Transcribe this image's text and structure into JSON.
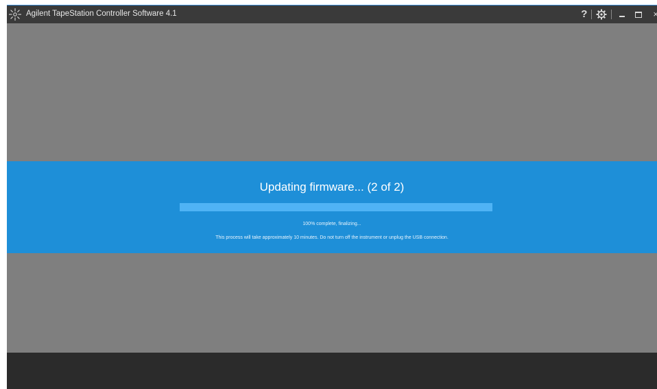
{
  "window": {
    "title": "Agilent TapeStation Controller Software 4.1",
    "accent_color": "#3a8ed8"
  },
  "titlebar": {
    "help_label": "?",
    "close_label": "×",
    "icons": [
      "app-logo-icon",
      "help-icon",
      "gear-icon",
      "minimize-icon",
      "maximize-icon",
      "close-icon"
    ]
  },
  "update": {
    "title": "Updating firmware... (2 of 2)",
    "progress_fraction": 1.0,
    "progress_text": "100% complete, finalizing...",
    "note": "This process will take approximately 10 minutes.  Do not turn off the instrument or unplug the USB connection.",
    "banner_color": "#1e8fd8"
  }
}
